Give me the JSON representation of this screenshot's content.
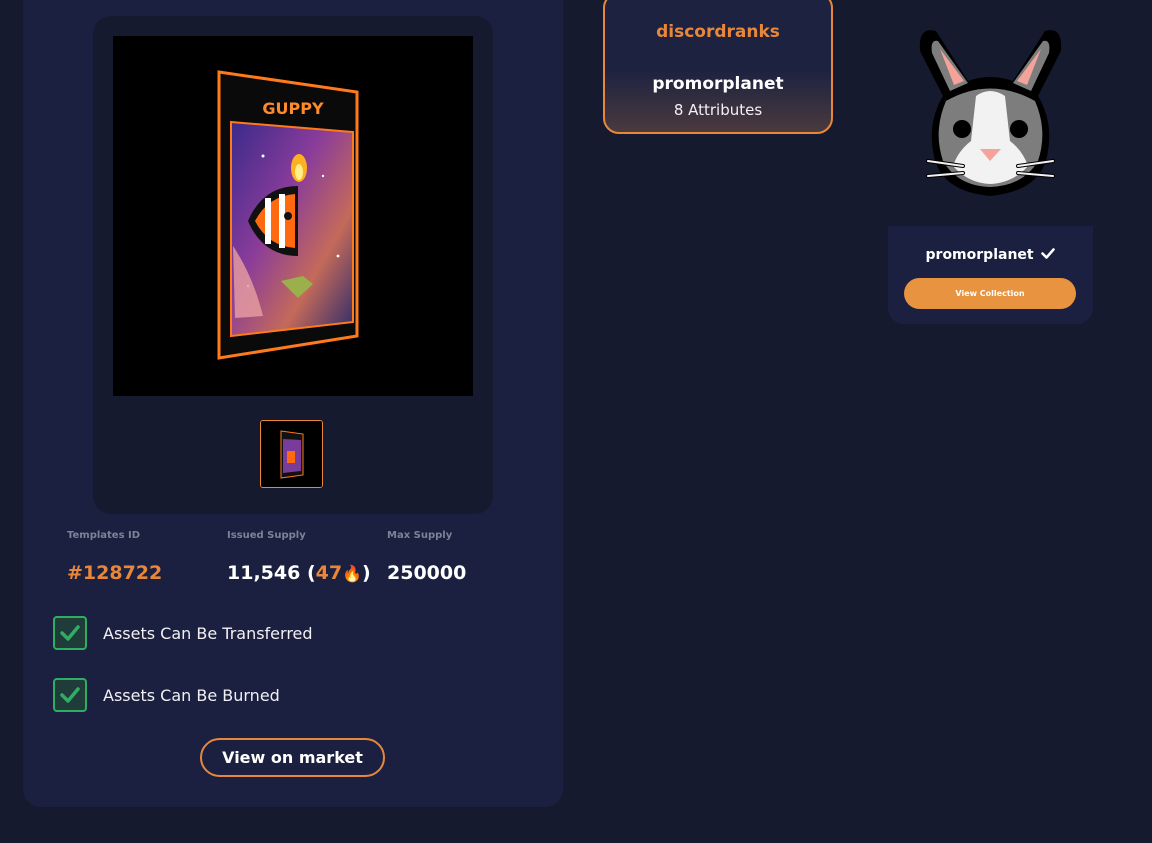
{
  "media": {
    "card_title": "GUPPY"
  },
  "stats": {
    "templates_id_label": "Templates ID",
    "templates_id_value": "#128722",
    "issued_label": "Issued Supply",
    "issued_value": "11,546",
    "issued_burned": "47",
    "issued_burn_icon": "🔥",
    "max_label": "Max Supply",
    "max_value": "250000"
  },
  "checks": {
    "transferable": "Assets Can Be Transferred",
    "burnable": "Assets Can Be Burned"
  },
  "market_button": "View on market",
  "attributes_card": {
    "title": "discordranks",
    "collection": "promorplanet",
    "count": "8 Attributes"
  },
  "collection_card": {
    "name": "promorplanet",
    "verified_icon": "check-icon",
    "button": "View Collection"
  },
  "colors": {
    "accent": "#e8873a",
    "check_green": "#2fae63",
    "background": "#161a2e",
    "card": "#1b2040"
  }
}
